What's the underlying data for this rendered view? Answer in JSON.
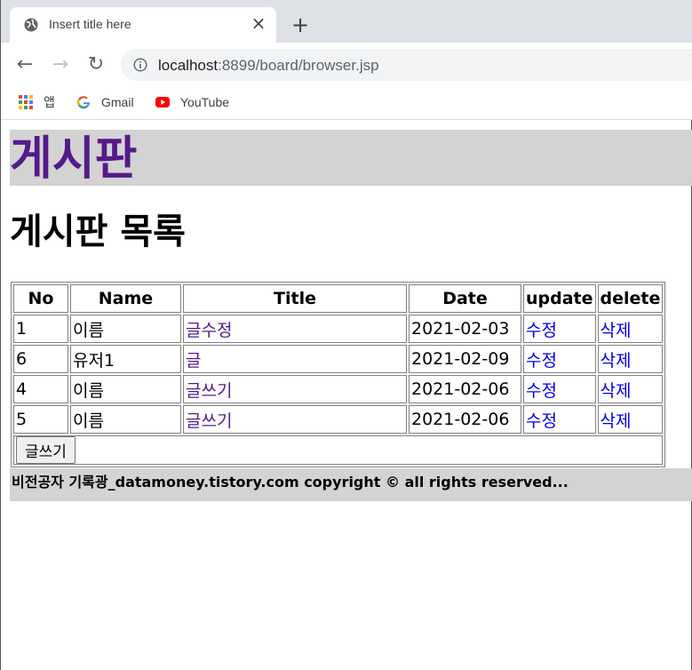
{
  "browser": {
    "tab_title": "Insert title here",
    "tab_close": "×",
    "new_tab": "+",
    "back": "←",
    "forward": "→",
    "reload": "↻",
    "url_host": "localhost",
    "url_rest": ":8899/board/browser.jsp",
    "bookmarks": [
      {
        "label": "앱",
        "icon": "apps-grid-icon"
      },
      {
        "label": "Gmail",
        "icon": "google-icon"
      },
      {
        "label": "YouTube",
        "icon": "youtube-icon"
      }
    ]
  },
  "page": {
    "banner_title": "게시판",
    "list_heading": "게시판 목록",
    "table": {
      "headers": [
        "No",
        "Name",
        "Title",
        "Date",
        "update",
        "delete"
      ],
      "rows": [
        {
          "no": "1",
          "name": "이름",
          "title": "글수정",
          "date": "2021-02-03",
          "update": "수정",
          "delete": "삭제"
        },
        {
          "no": "6",
          "name": "유저1",
          "title": "글",
          "date": "2021-02-09",
          "update": "수정",
          "delete": "삭제"
        },
        {
          "no": "4",
          "name": "이름",
          "title": "글쓰기",
          "date": "2021-02-06",
          "update": "수정",
          "delete": "삭제"
        },
        {
          "no": "5",
          "name": "이름",
          "title": "글쓰기",
          "date": "2021-02-06",
          "update": "수정",
          "delete": "삭제"
        }
      ],
      "write_button": "글쓰기"
    },
    "footer": "비전공자 기록광_datamoney.tistory.com copyright © all rights reserved..."
  },
  "colors": {
    "banner_bg": "#d3d3d3",
    "visited_link": "#551a8b",
    "link": "#0000ee"
  }
}
